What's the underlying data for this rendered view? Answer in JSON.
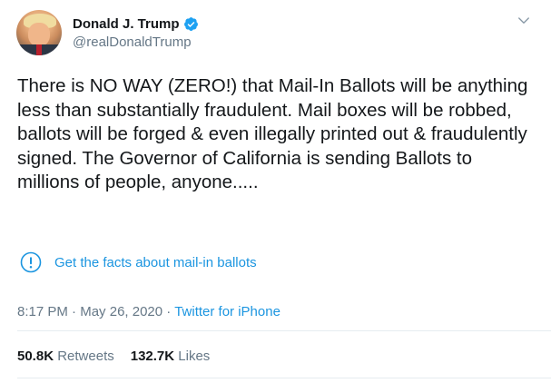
{
  "author": {
    "display_name": "Donald J. Trump",
    "handle": "@realDonaldTrump",
    "verified": true
  },
  "tweet": {
    "text": "There is NO WAY (ZERO!) that Mail-In Ballots will be anything less than substantially fraudulent. Mail boxes will be robbed, ballots will be forged & even illegally printed out & fraudulently signed. The Governor of California is sending Ballots to millions of people, anyone.....",
    "notice": {
      "icon": "exclamation-circle-icon",
      "label": "Get the facts about mail-in ballots"
    },
    "time": "8:17 PM",
    "separator": "·",
    "date": "May 26, 2020",
    "source": "Twitter for iPhone"
  },
  "stats": {
    "retweets_count": "50.8K",
    "retweets_label": "Retweets",
    "likes_count": "132.7K",
    "likes_label": "Likes"
  },
  "colors": {
    "link": "#1b95e0",
    "text": "#14171a",
    "secondary": "#657786",
    "divider": "#e6ecf0"
  }
}
